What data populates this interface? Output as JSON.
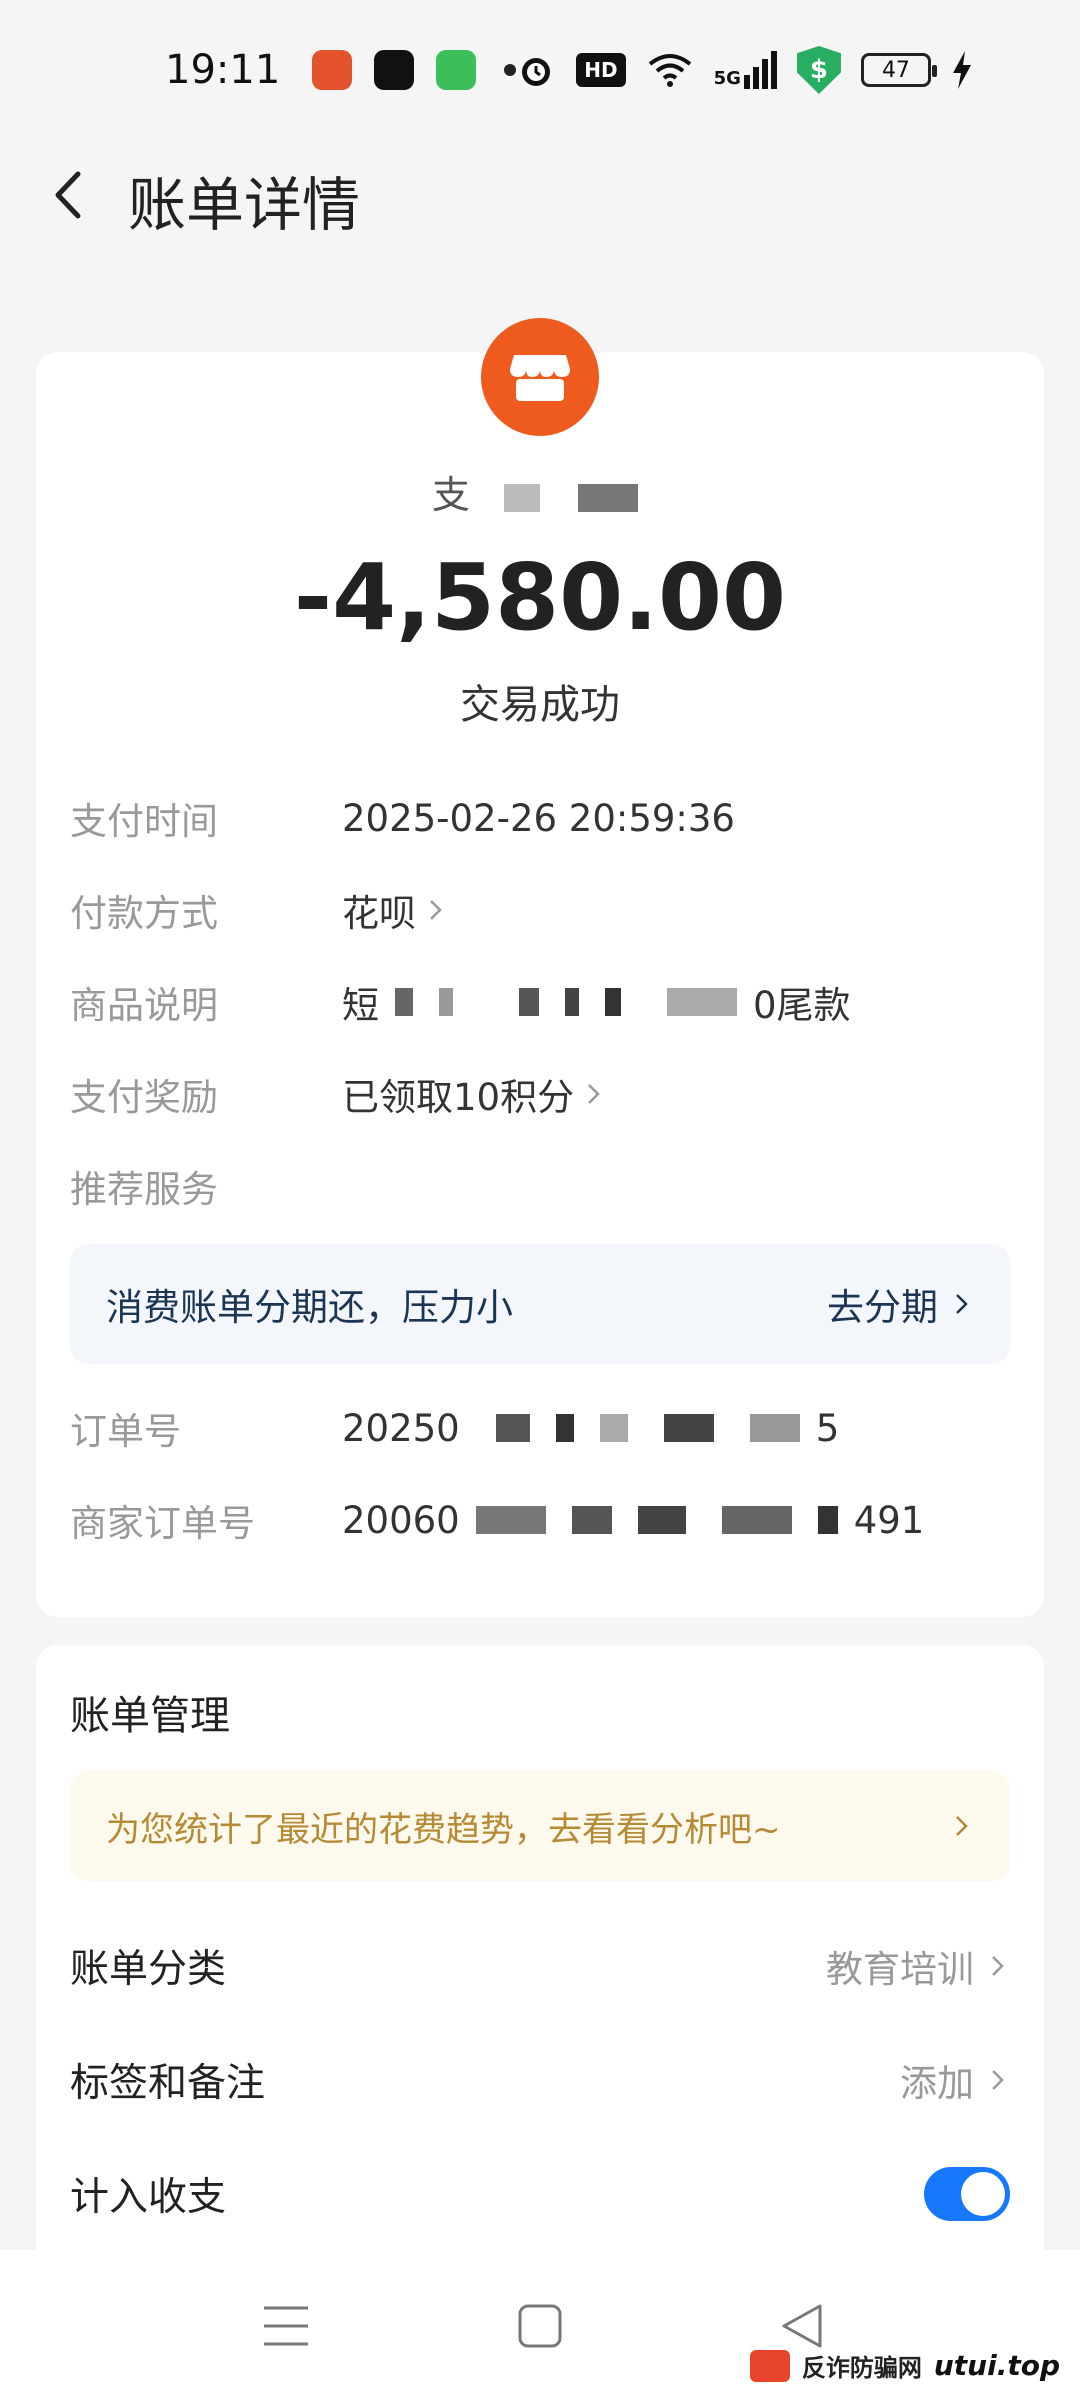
{
  "status_bar": {
    "time": "19:11",
    "hd": "HD",
    "network": "5G",
    "battery": "47",
    "shield_symbol": "$"
  },
  "nav": {
    "title": "账单详情"
  },
  "bill": {
    "merchant_name": "支",
    "amount": "-4,580.00",
    "status": "交易成功"
  },
  "details": {
    "pay_time_label": "支付时间",
    "pay_time_value": "2025-02-26 20:59:36",
    "pay_method_label": "付款方式",
    "pay_method_value": "花呗",
    "goods_label": "商品说明",
    "goods_value_start": "短",
    "goods_value_end": "0尾款",
    "reward_label": "支付奖励",
    "reward_value": "已领取10积分",
    "recommend_label": "推荐服务",
    "installment_text": "消费账单分期还，压力小",
    "installment_action": "去分期",
    "order_no_label": "订单号",
    "order_no_start": "20250",
    "order_no_end": "5",
    "merchant_order_label": "商家订单号",
    "merchant_order_start": "20060",
    "merchant_order_end": "491"
  },
  "manage": {
    "title": "账单管理",
    "tip": "为您统计了最近的花费趋势，去看看分析吧~",
    "category_label": "账单分类",
    "category_value": "教育培训",
    "tag_label": "标签和备注",
    "tag_value": "添加",
    "count_label": "计入收支",
    "count_enabled": true
  },
  "watermark": {
    "text": "反诈防骗网",
    "url": "utui.top"
  },
  "colors": {
    "accent": "#1677ff",
    "merchant_icon": "#ef5b1f",
    "tip_text": "#b68a34"
  }
}
